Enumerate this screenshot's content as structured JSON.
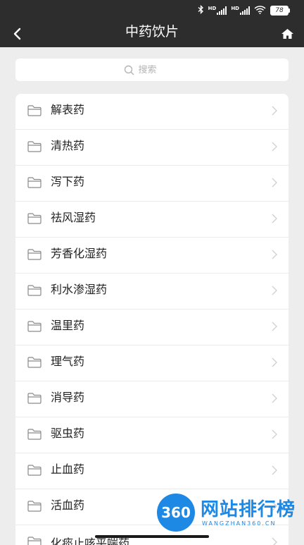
{
  "status_bar": {
    "battery": "78",
    "network_1": "HD",
    "network_2": "HD"
  },
  "navbar": {
    "title": "中药饮片"
  },
  "search": {
    "placeholder": "搜索"
  },
  "categories": [
    {
      "label": "解表药"
    },
    {
      "label": "清热药"
    },
    {
      "label": "泻下药"
    },
    {
      "label": "祛风湿药"
    },
    {
      "label": "芳香化湿药"
    },
    {
      "label": "利水渗湿药"
    },
    {
      "label": "温里药"
    },
    {
      "label": "理气药"
    },
    {
      "label": "消导药"
    },
    {
      "label": "驱虫药"
    },
    {
      "label": "止血药"
    },
    {
      "label": "活血药"
    },
    {
      "label": "化痰止咳平喘药"
    }
  ],
  "watermark": {
    "logo": "360",
    "text": "网站排行榜",
    "subtext": "WANGZHAN360.CN"
  },
  "colors": {
    "header_bg": "#2d2d2d",
    "page_bg": "#ededed",
    "card_bg": "#ffffff",
    "watermark_blue": "#1e88e5"
  }
}
